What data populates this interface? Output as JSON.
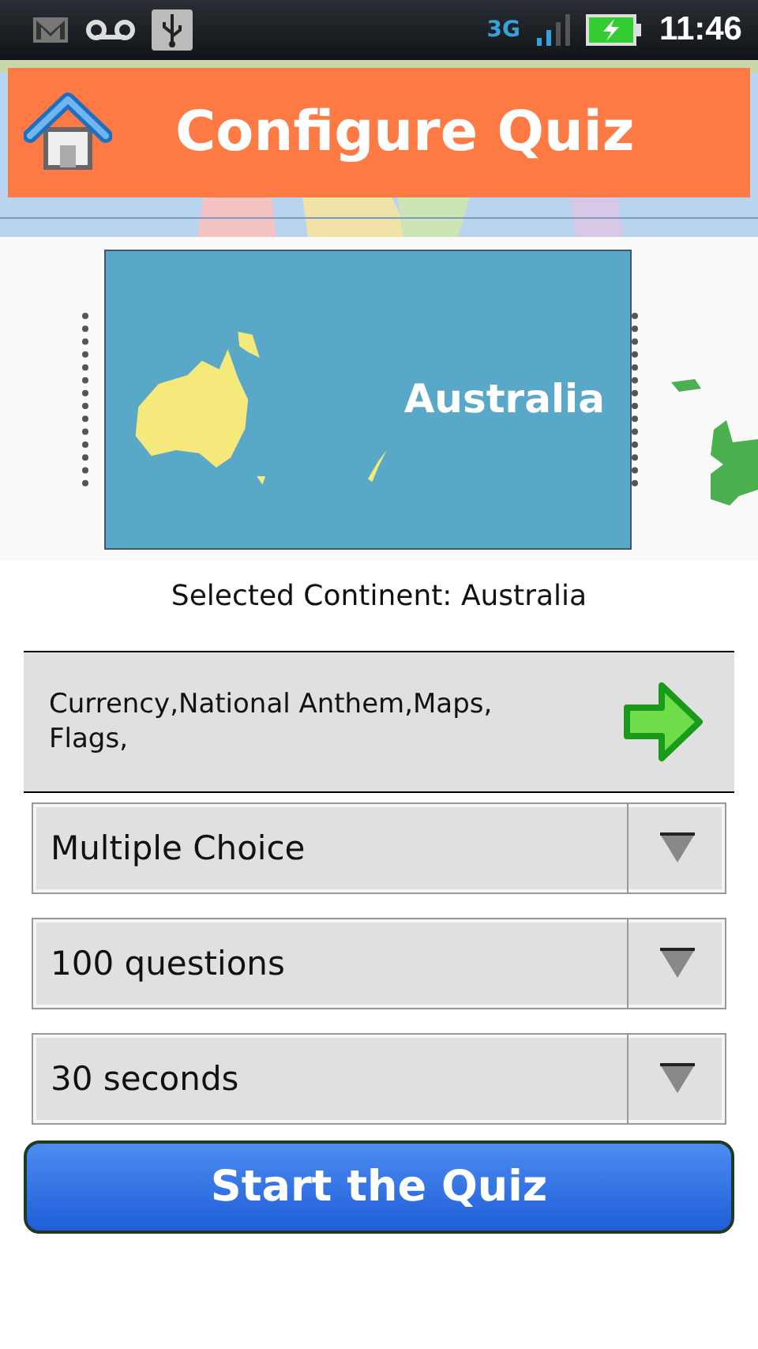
{
  "status_bar": {
    "network": "3G",
    "time": "11:46"
  },
  "header": {
    "title": "Configure Quiz"
  },
  "carousel": {
    "card_label": "Australia"
  },
  "selected_continent": "Selected Continent: Australia",
  "topics": {
    "text": "Currency,National Anthem,Maps, Flags,"
  },
  "dropdowns": [
    {
      "value": "Multiple Choice"
    },
    {
      "value": "100 questions"
    },
    {
      "value": "30 seconds"
    }
  ],
  "start_button": "Start the Quiz"
}
